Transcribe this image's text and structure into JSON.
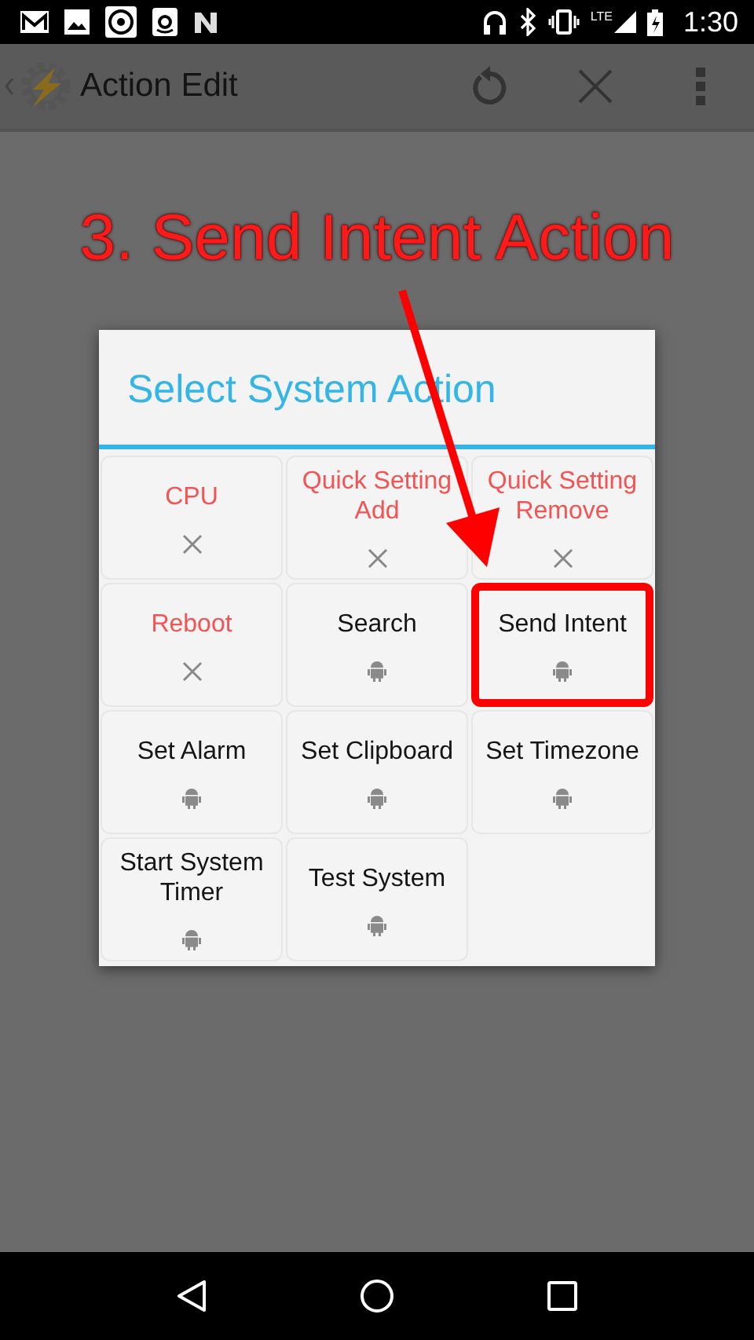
{
  "status_bar": {
    "time": "1:30",
    "network": "LTE"
  },
  "app_bar": {
    "title": "Action Edit"
  },
  "annotation": {
    "text": "3. Send Intent Action"
  },
  "dialog": {
    "title": "Select System Action",
    "items": [
      {
        "label": "CPU",
        "kind": "unavailable",
        "highlighted": false
      },
      {
        "label": "Quick Setting Add",
        "kind": "unavailable",
        "highlighted": false
      },
      {
        "label": "Quick Setting Remove",
        "kind": "unavailable",
        "highlighted": false
      },
      {
        "label": "Reboot",
        "kind": "unavailable",
        "highlighted": false
      },
      {
        "label": "Search",
        "kind": "available",
        "highlighted": false
      },
      {
        "label": "Send Intent",
        "kind": "available",
        "highlighted": true
      },
      {
        "label": "Set Alarm",
        "kind": "available",
        "highlighted": false
      },
      {
        "label": "Set Clipboard",
        "kind": "available",
        "highlighted": false
      },
      {
        "label": "Set Timezone",
        "kind": "available",
        "highlighted": false
      },
      {
        "label": "Start System Timer",
        "kind": "available",
        "highlighted": false
      },
      {
        "label": "Test System",
        "kind": "available",
        "highlighted": false
      }
    ]
  }
}
